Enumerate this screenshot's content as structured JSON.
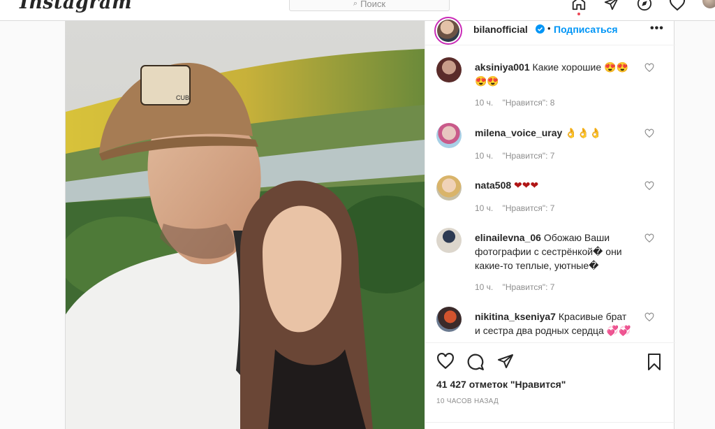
{
  "header": {
    "logo": "Instagram",
    "search_placeholder": "Поиск",
    "nav_icons": [
      "home-icon",
      "direct-icon",
      "explore-icon",
      "activity-icon",
      "profile-avatar"
    ]
  },
  "post": {
    "author": "bilanofficial",
    "follow_label": "Подписаться",
    "more_label": "•••",
    "likes": "41 427 отметок \"Нравится\"",
    "time": "10 ЧАСОВ НАЗАД",
    "photo_logo_text": "CUB"
  },
  "comments": [
    {
      "user": "aksiniya001",
      "text": "Какие хорошие 😍😍😍😍",
      "age": "10 ч.",
      "likes": "\"Нравится\": 8"
    },
    {
      "user": "milena_voice_uray",
      "text": "👌👌👌",
      "age": "10 ч.",
      "likes": "\"Нравится\": 7"
    },
    {
      "user": "nata508",
      "text": "❤❤❤",
      "age": "10 ч.",
      "likes": "\"Нравится\": 7"
    },
    {
      "user": "elinailevna_06",
      "text": "Обожаю Ваши фотографии с сестрёнкой� они какие-то теплые, уютные�",
      "age": "10 ч.",
      "likes": "\"Нравится\": 7"
    },
    {
      "user": "nikitina_kseniya7",
      "text": "Красивые брат и сестра два родных сердца 💞💞",
      "age": "",
      "likes": ""
    }
  ],
  "colors": {
    "accent": "#0095f6",
    "text": "#262626",
    "muted": "#8e8e8e",
    "border": "#dbdbdb",
    "notification": "#ed4956"
  }
}
